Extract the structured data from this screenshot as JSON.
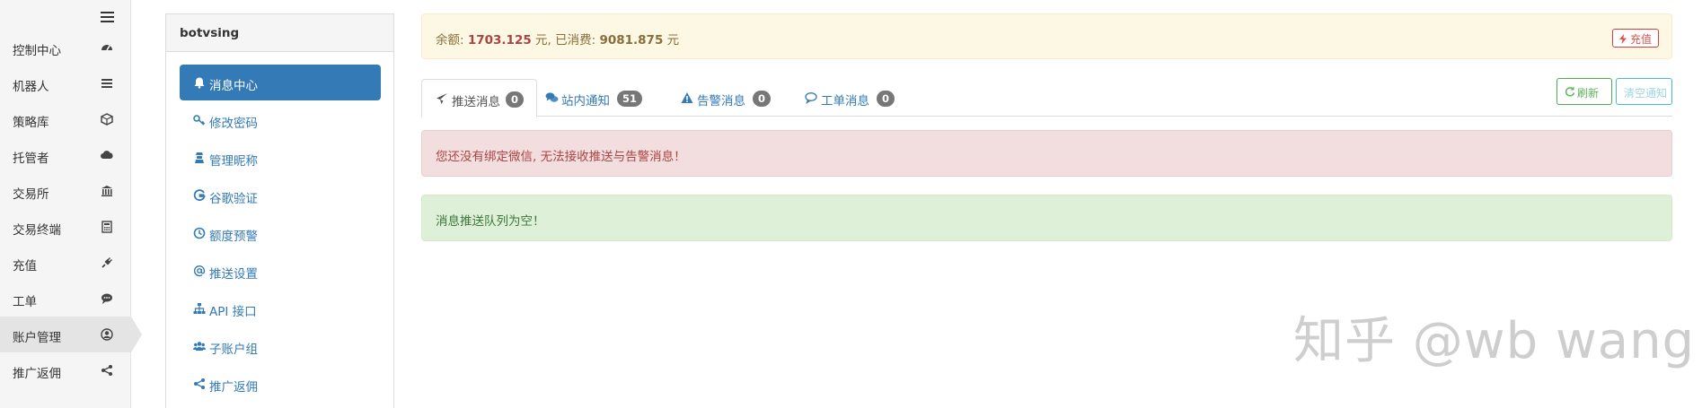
{
  "sidebar": {
    "items": [
      {
        "label": "控制中心",
        "icon": "dashboard-icon"
      },
      {
        "label": "机器人",
        "icon": "list-icon"
      },
      {
        "label": "策略库",
        "icon": "cube-icon"
      },
      {
        "label": "托管者",
        "icon": "cloud-icon"
      },
      {
        "label": "交易所",
        "icon": "bank-icon"
      },
      {
        "label": "交易终端",
        "icon": "calculator-icon"
      },
      {
        "label": "充值",
        "icon": "plug-icon"
      },
      {
        "label": "工单",
        "icon": "comment-icon"
      },
      {
        "label": "账户管理",
        "icon": "user-circle-icon",
        "active": true
      },
      {
        "label": "推广返佣",
        "icon": "share-icon"
      }
    ]
  },
  "account_menu": {
    "title": "botvsing",
    "items": [
      {
        "label": "消息中心",
        "icon": "bell-icon",
        "active": true
      },
      {
        "label": "修改密码",
        "icon": "key-icon"
      },
      {
        "label": "管理昵称",
        "icon": "user-secret-icon"
      },
      {
        "label": "谷歌验证",
        "icon": "google-icon"
      },
      {
        "label": "额度预警",
        "icon": "clock-icon"
      },
      {
        "label": "推送设置",
        "icon": "at-icon"
      },
      {
        "label": "API 接口",
        "icon": "sitemap-icon"
      },
      {
        "label": "子账户组",
        "icon": "users-icon"
      },
      {
        "label": "推广返佣",
        "icon": "share-icon"
      }
    ]
  },
  "balance": {
    "balance_label": "余额: ",
    "balance_value": "1703.125",
    "unit_1": " 元, 已消费: ",
    "spent_value": "9081.875",
    "unit_2": " 元",
    "recharge_button": "充值"
  },
  "tabs": [
    {
      "label": "推送消息",
      "count": "0",
      "icon": "send-icon",
      "active": true
    },
    {
      "label": "站内通知",
      "count": "51",
      "icon": "comments-icon"
    },
    {
      "label": "告警消息",
      "count": "0",
      "icon": "warning-icon"
    },
    {
      "label": "工单消息",
      "count": "0",
      "icon": "comment-o-icon"
    }
  ],
  "actions": {
    "refresh": "刷新",
    "clear": "清空通知"
  },
  "alerts": {
    "wechat": "您还没有绑定微信, 无法接收推送与告警消息！",
    "queue": "消息推送队列为空！"
  },
  "watermark": "知乎 @wb wang",
  "colors": {
    "primary": "#337ab7",
    "danger": "#d9534f",
    "success": "#5cb85c",
    "info": "#46b8da"
  }
}
